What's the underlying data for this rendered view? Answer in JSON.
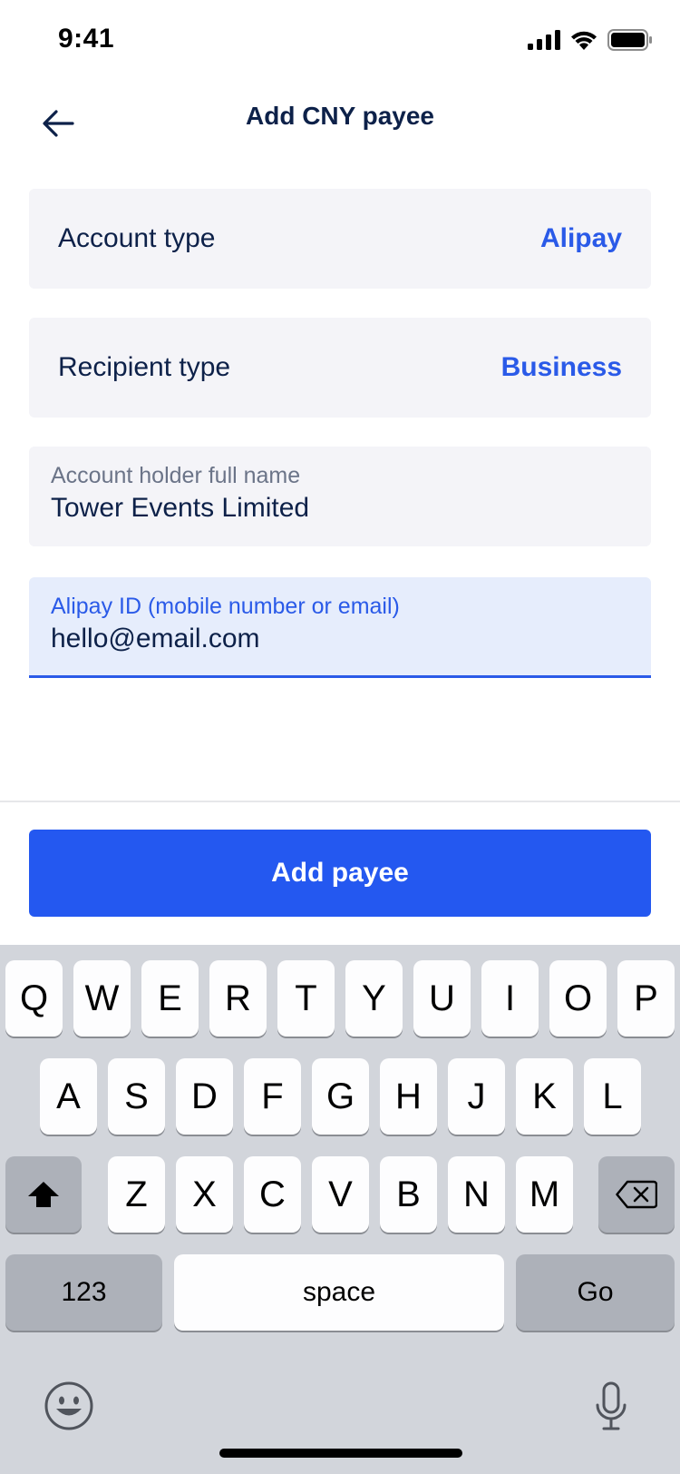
{
  "status_bar": {
    "time": "9:41",
    "icons": [
      "cellular-signal-icon",
      "wifi-icon",
      "battery-icon"
    ]
  },
  "header": {
    "back_icon": "arrow-left-icon",
    "title": "Add CNY payee"
  },
  "form": {
    "account_type": {
      "label": "Account type",
      "value": "Alipay"
    },
    "recipient_type": {
      "label": "Recipient type",
      "value": "Business"
    },
    "holder_name": {
      "label": "Account holder full name",
      "value": "Tower Events Limited"
    },
    "alipay_id": {
      "label": "Alipay ID (mobile number or email)",
      "value": "hello@email.com"
    }
  },
  "actions": {
    "add_payee_label": "Add payee"
  },
  "keyboard": {
    "row1": [
      "Q",
      "W",
      "E",
      "R",
      "T",
      "Y",
      "U",
      "I",
      "O",
      "P"
    ],
    "row2": [
      "A",
      "S",
      "D",
      "F",
      "G",
      "H",
      "J",
      "K",
      "L"
    ],
    "row3": [
      "Z",
      "X",
      "C",
      "V",
      "B",
      "N",
      "M"
    ],
    "numbers_label": "123",
    "space_label": "space",
    "go_label": "Go",
    "icons": [
      "shift-icon",
      "backspace-icon",
      "emoji-icon",
      "microphone-icon"
    ]
  },
  "colors": {
    "accent": "#2458f0",
    "text_primary": "#0d2149",
    "field_bg": "#f4f4f8",
    "active_field_bg": "#e6edfc",
    "keyboard_bg": "#d2d5db"
  }
}
